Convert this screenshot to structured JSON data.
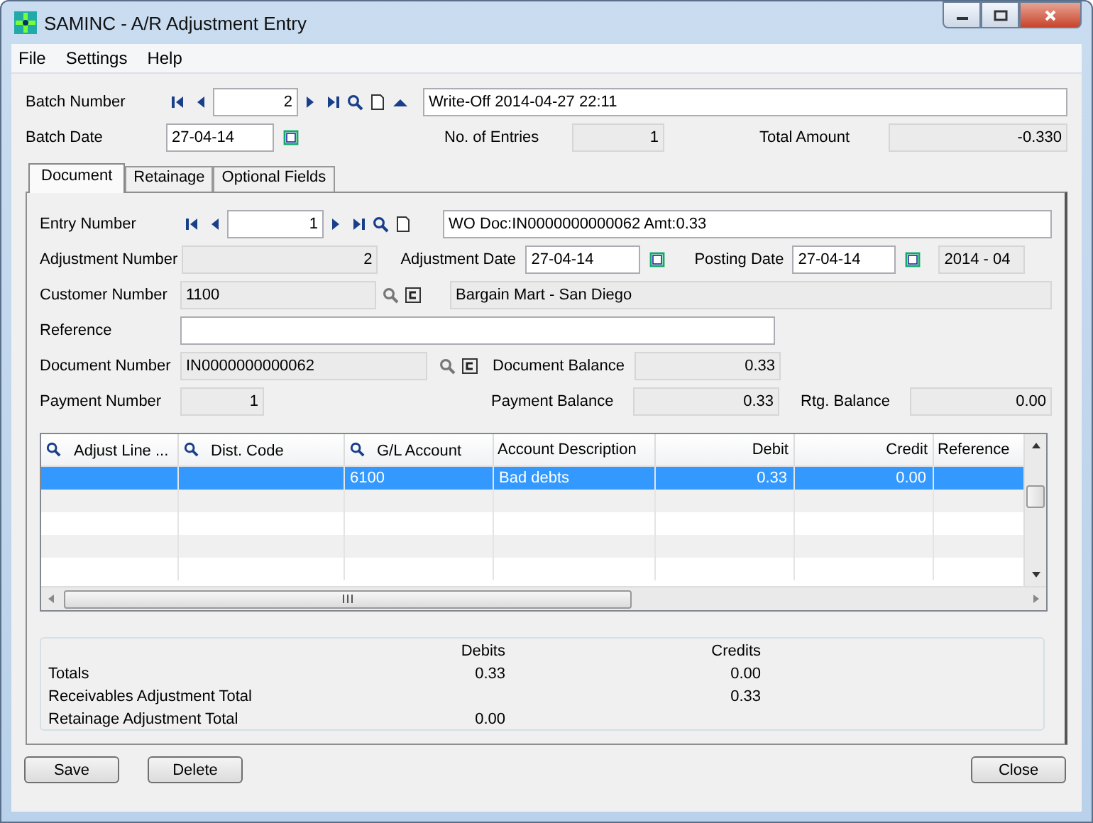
{
  "window": {
    "title": "SAMINC - A/R Adjustment Entry"
  },
  "menu": [
    "File",
    "Settings",
    "Help"
  ],
  "batch": {
    "number_label": "Batch Number",
    "number": "2",
    "description": "Write-Off 2014-04-27 22:11",
    "date_label": "Batch Date",
    "date": "27-04-14",
    "entries_label": "No. of Entries",
    "entries": "1",
    "total_label": "Total Amount",
    "total": "-0.330"
  },
  "tabs": [
    {
      "label": "Document",
      "selected": true
    },
    {
      "label": "Retainage",
      "selected": false
    },
    {
      "label": "Optional Fields",
      "selected": false
    }
  ],
  "entry": {
    "number_label": "Entry Number",
    "number": "1",
    "description": "WO Doc:IN0000000000062 Amt:0.33",
    "adjustment_number_label": "Adjustment Number",
    "adjustment_number": "2",
    "adjustment_date_label": "Adjustment Date",
    "adjustment_date": "27-04-14",
    "posting_date_label": "Posting Date",
    "posting_date": "27-04-14",
    "period": "2014 - 04",
    "customer_label": "Customer Number",
    "customer_number": "1100",
    "customer_name": "Bargain Mart - San Diego",
    "reference_label": "Reference",
    "document_label": "Document Number",
    "document_number": "IN0000000000062",
    "document_balance_label": "Document Balance",
    "document_balance": "0.33",
    "payment_label": "Payment Number",
    "payment_number": "1",
    "payment_balance_label": "Payment Balance",
    "payment_balance": "0.33",
    "rtg_balance_label": "Rtg. Balance",
    "rtg_balance": "0.00"
  },
  "table": {
    "columns": [
      {
        "label": "Adjust Line ...",
        "search": true,
        "kind": "text"
      },
      {
        "label": "Dist. Code",
        "search": true,
        "kind": "text"
      },
      {
        "label": "G/L Account",
        "search": true,
        "kind": "text"
      },
      {
        "label": "Account Description",
        "search": false,
        "kind": "text"
      },
      {
        "label": "Debit",
        "search": false,
        "kind": "amount"
      },
      {
        "label": "Credit",
        "search": false,
        "kind": "amount"
      },
      {
        "label": "Reference",
        "search": false,
        "kind": "text"
      }
    ],
    "rows": [
      {
        "selected": true,
        "cells": [
          "",
          "",
          "6100",
          "Bad debts",
          "0.33",
          "0.00",
          ""
        ]
      }
    ]
  },
  "totals": {
    "debits_header": "Debits",
    "credits_header": "Credits",
    "rows": [
      {
        "label": "Totals",
        "debit": "0.33",
        "credit": "0.00"
      },
      {
        "label": "Receivables Adjustment Total",
        "credit": "0.33"
      },
      {
        "label": "Retainage Adjustment Total",
        "debit": "0.00"
      }
    ]
  },
  "buttons": {
    "left": [
      "Save",
      "Delete"
    ],
    "right": [
      "Close"
    ]
  }
}
